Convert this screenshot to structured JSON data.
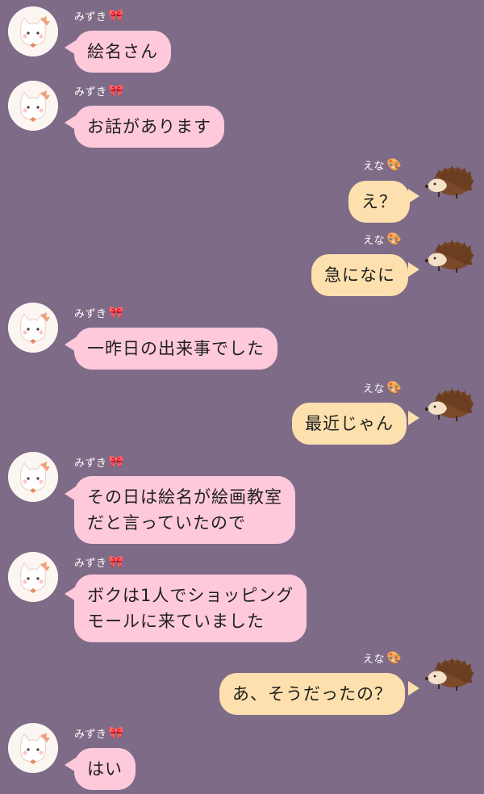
{
  "users": {
    "mizuki": {
      "name": "みずき",
      "badge": "🎀",
      "avatar_icon": "white-cat-with-bow-icon"
    },
    "ena": {
      "name": "えな",
      "badge": "🎨",
      "avatar_icon": "hedgehog-icon"
    }
  },
  "messages": [
    {
      "speaker": "mizuki",
      "lines": [
        "絵名さん"
      ]
    },
    {
      "speaker": "mizuki",
      "lines": [
        "お話があります"
      ]
    },
    {
      "speaker": "ena",
      "lines": [
        "え？"
      ]
    },
    {
      "speaker": "ena",
      "lines": [
        "急になに"
      ]
    },
    {
      "speaker": "mizuki",
      "lines": [
        "一昨日の出来事でした"
      ]
    },
    {
      "speaker": "ena",
      "lines": [
        "最近じゃん"
      ]
    },
    {
      "speaker": "mizuki",
      "lines": [
        "その日は絵名が絵画教室",
        "だと言っていたので"
      ]
    },
    {
      "speaker": "mizuki",
      "lines": [
        "ボクは1人でショッピング",
        "モールに来ていました"
      ]
    },
    {
      "speaker": "ena",
      "lines": [
        "あ、そうだったの？"
      ]
    },
    {
      "speaker": "mizuki",
      "lines": [
        "はい"
      ]
    }
  ],
  "colors": {
    "background": "#7e6b87",
    "left_bubble": "#ffc9dc",
    "right_bubble": "#fde0ad"
  }
}
